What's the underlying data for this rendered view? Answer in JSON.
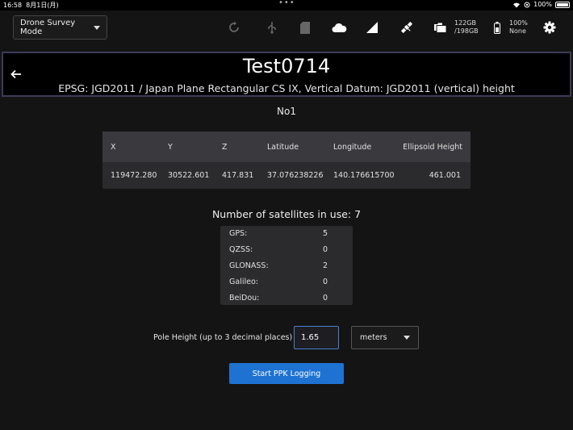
{
  "status_bar": {
    "time": "16:58",
    "date": "8月1日(月)",
    "multitask": "•••",
    "battery": "100%"
  },
  "toolbar": {
    "mode": "Drone Survey Mode",
    "storage_free": "122GB",
    "storage_total": "/198GB",
    "receiver_battery": "100%",
    "receiver_status": "None"
  },
  "header": {
    "title": "Test0714",
    "subtitle": "EPSG: JGD2011 / Japan Plane Rectangular CS IX, Vertical Datum: JGD2011 (vertical) height"
  },
  "point": {
    "name": "No1"
  },
  "coordinates": {
    "headers": [
      "X",
      "Y",
      "Z",
      "Latitude",
      "Longitude",
      "Ellipsoid Height"
    ],
    "values": [
      "119472.280",
      "30522.601",
      "417.831",
      "37.076238226",
      "140.176615700",
      "461.001"
    ]
  },
  "satellites": {
    "title": "Number of satellites in use: 7",
    "rows": [
      {
        "name": "GPS:",
        "count": "5"
      },
      {
        "name": "QZSS:",
        "count": "0"
      },
      {
        "name": "GLONASS:",
        "count": "2"
      },
      {
        "name": "Galileo:",
        "count": "0"
      },
      {
        "name": "BeiDou:",
        "count": "0"
      }
    ]
  },
  "pole": {
    "label": "Pole Height (up to 3 decimal places)",
    "value": "1.65",
    "unit": "meters"
  },
  "actions": {
    "start_label": "Start PPK Logging"
  }
}
